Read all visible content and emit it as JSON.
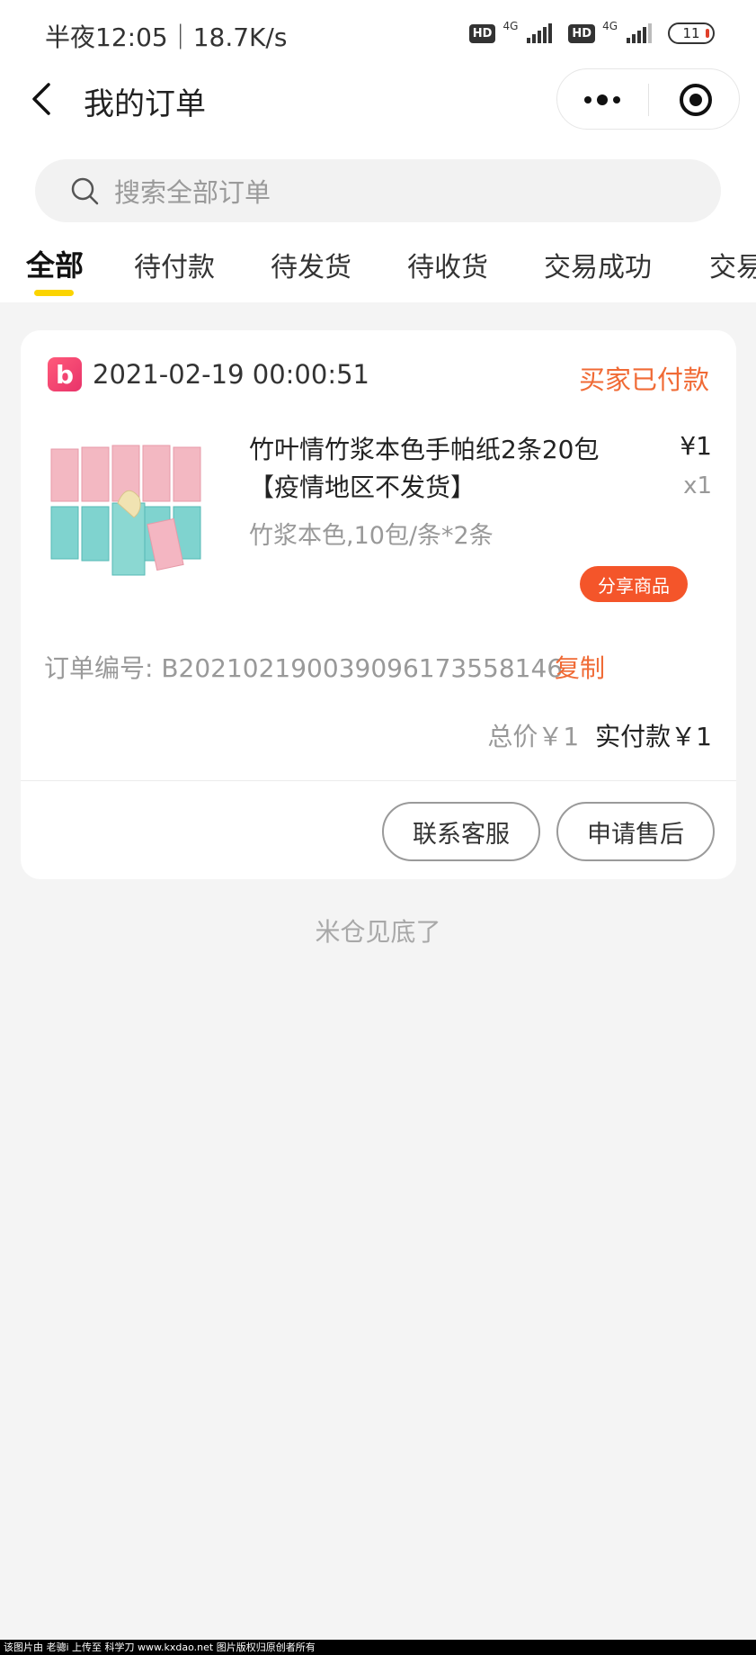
{
  "status_bar": {
    "time_speed": "半夜12:05｜18.7K/s",
    "hd_label": "HD",
    "network_label": "4G",
    "battery": "11"
  },
  "nav": {
    "title": "我的订单"
  },
  "search": {
    "placeholder": "搜索全部订单"
  },
  "tabs": [
    {
      "label": "全部",
      "active": true
    },
    {
      "label": "待付款",
      "active": false
    },
    {
      "label": "待发货",
      "active": false
    },
    {
      "label": "待收货",
      "active": false
    },
    {
      "label": "交易成功",
      "active": false
    },
    {
      "label": "交易",
      "active": false
    }
  ],
  "order": {
    "shop_logo_letter": "b",
    "datetime": "2021-02-19 00:00:51",
    "status": "买家已付款",
    "product_name": "竹叶情竹浆本色手帕纸2条20包【疫情地区不发货】",
    "price": "¥1",
    "quantity": "x1",
    "spec": "竹浆本色,10包/条*2条",
    "share_label": "分享商品",
    "order_no": "订单编号: B2021021900390961735581​46",
    "copy_label": "复制",
    "total_price": "总价￥1",
    "paid_amount": "实付款￥1",
    "buttons": {
      "service": "联系客服",
      "aftersale": "申请售后"
    }
  },
  "end_text": "米仓见底了",
  "watermark": "该图片由 老骢i 上传至 科学刀 www.kxdao.net 图片版权归原创者所有",
  "colors": {
    "accent_orange": "#f06a35",
    "tab_underline": "#fbd400",
    "share_button": "#f4552a"
  }
}
